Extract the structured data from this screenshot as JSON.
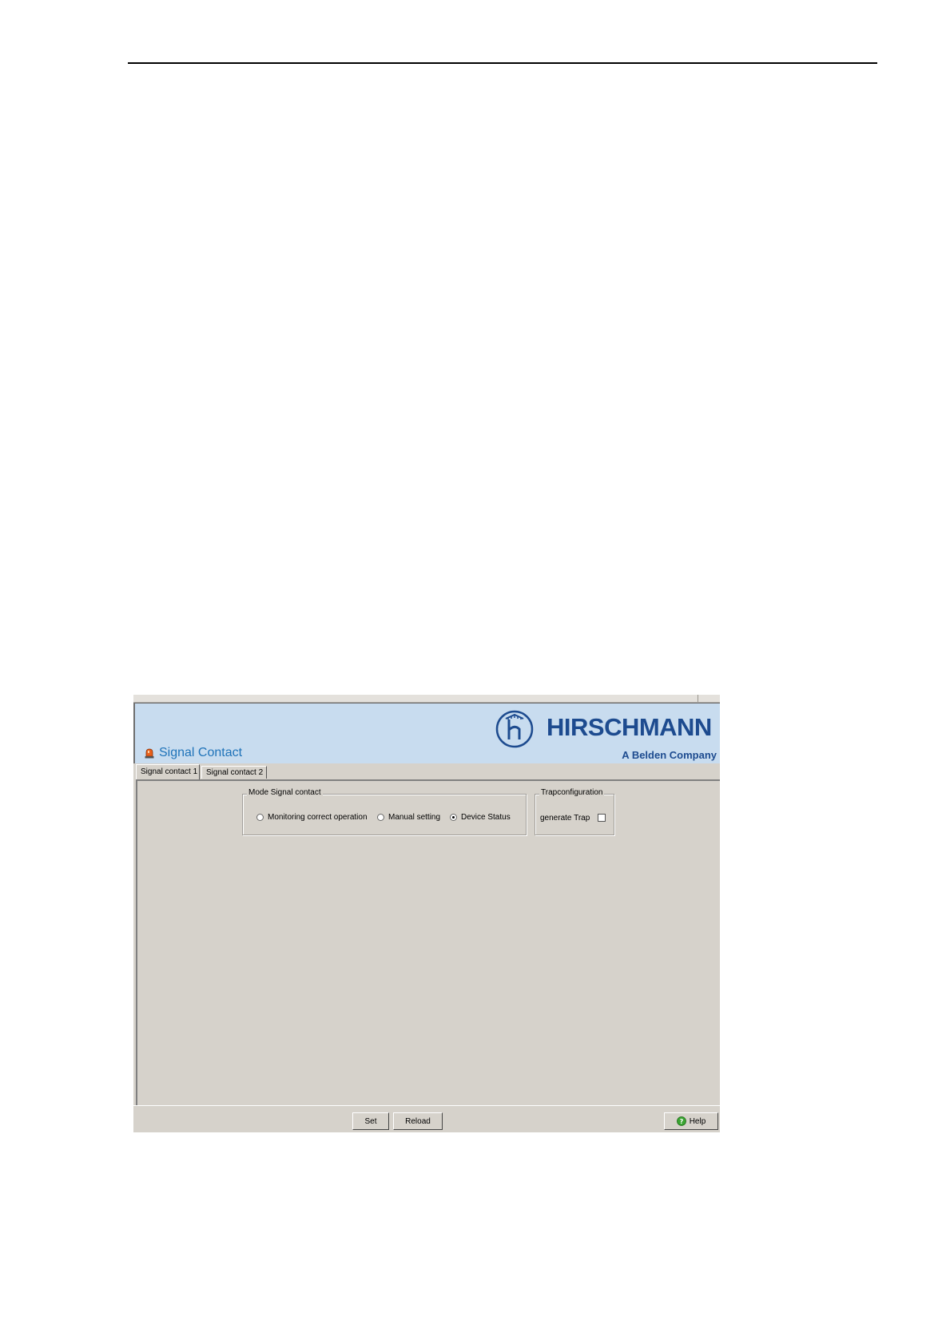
{
  "brand": {
    "name": "HIRSCHMANN",
    "subtitle": "A Belden Company",
    "colors": {
      "brand_blue": "#1d4b8f",
      "banner_bg": "#c8dcef",
      "title_blue": "#1f73b9",
      "panel_bg": "#d6d2cb"
    }
  },
  "page": {
    "title": "Signal Contact",
    "icon": "alarm-light-icon"
  },
  "tabs": [
    {
      "label": "Signal contact 1",
      "active": true
    },
    {
      "label": "Signal contact 2",
      "active": false
    }
  ],
  "mode_group": {
    "legend": "Mode Signal contact",
    "options": [
      {
        "label": "Monitoring correct operation",
        "checked": false
      },
      {
        "label": "Manual setting",
        "checked": false
      },
      {
        "label": "Device Status",
        "checked": true
      }
    ]
  },
  "trap_group": {
    "legend": "Trapconfiguration",
    "generate_trap_label": "generate Trap",
    "generate_trap_checked": false
  },
  "buttons": {
    "set": "Set",
    "reload": "Reload",
    "help": "Help"
  }
}
